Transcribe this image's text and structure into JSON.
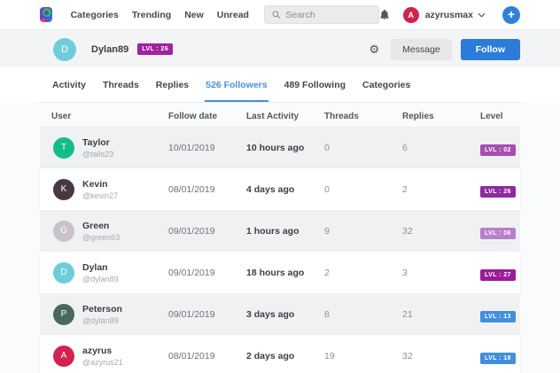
{
  "navbar": {
    "items": [
      "Categories",
      "Trending",
      "New",
      "Unread"
    ],
    "search_placeholder": "Search",
    "username": "azyrusmax",
    "user_avatar_letter": "A",
    "user_avatar_color": "#d2224e",
    "plus_color": "#2e82d8"
  },
  "profile": {
    "avatar_letter": "D",
    "avatar_color": "#6fcddb",
    "name": "Dylan89",
    "level_badge": "LVL : 26",
    "level_badge_color": "#a2219e",
    "message_label": "Message",
    "follow_label": "Follow",
    "follow_color": "#2b7cd9"
  },
  "tabs": [
    {
      "label": "Activity"
    },
    {
      "label": "Threads"
    },
    {
      "label": "Replies"
    },
    {
      "label": "526 Followers"
    },
    {
      "label": "489 Following"
    },
    {
      "label": "Categories"
    }
  ],
  "active_tab": "526 Followers",
  "table": {
    "columns": [
      "User",
      "Follow date",
      "Last Activity",
      "Threads",
      "Replies",
      "Level"
    ],
    "rows": [
      {
        "name": "Taylor",
        "handle": "@tails23",
        "initial": "T",
        "avatar_color": "#13bd8a",
        "follow_date": "10/01/2019",
        "last_activity": "10 hours ago",
        "threads": "0",
        "replies": "6",
        "level": "LVL : 02",
        "level_color": "#a74fb0"
      },
      {
        "name": "Kevin",
        "handle": "@kevin27",
        "initial": "K",
        "avatar_color": "#463844",
        "follow_date": "08/01/2019",
        "last_activity": "4 days ago",
        "threads": "0",
        "replies": "2",
        "level": "LVL : 26",
        "level_color": "#8d2aa0"
      },
      {
        "name": "Green",
        "handle": "@green63",
        "initial": "G",
        "avatar_color": "#c9c2cc",
        "follow_date": "09/01/2019",
        "last_activity": "1 hours ago",
        "threads": "9",
        "replies": "32",
        "level": "LVL : 06",
        "level_color": "#b97fc9"
      },
      {
        "name": "Dylan",
        "handle": "@dylan89",
        "initial": "D",
        "avatar_color": "#6fcddb",
        "follow_date": "09/01/2019",
        "last_activity": "18 hours ago",
        "threads": "2",
        "replies": "3",
        "level": "LVL : 27",
        "level_color": "#9a1c96"
      },
      {
        "name": "Peterson",
        "handle": "@dylan89",
        "initial": "P",
        "avatar_color": "#48695f",
        "follow_date": "09/01/2019",
        "last_activity": "3 days ago",
        "threads": "8",
        "replies": "21",
        "level": "LVL : 13",
        "level_color": "#418fdd"
      },
      {
        "name": "azyrus",
        "handle": "@azyrus21",
        "initial": "A",
        "avatar_color": "#d2224e",
        "follow_date": "08/01/2019",
        "last_activity": "2 days ago",
        "threads": "19",
        "replies": "32",
        "level": "LVL : 18",
        "level_color": "#418fdd"
      }
    ]
  }
}
